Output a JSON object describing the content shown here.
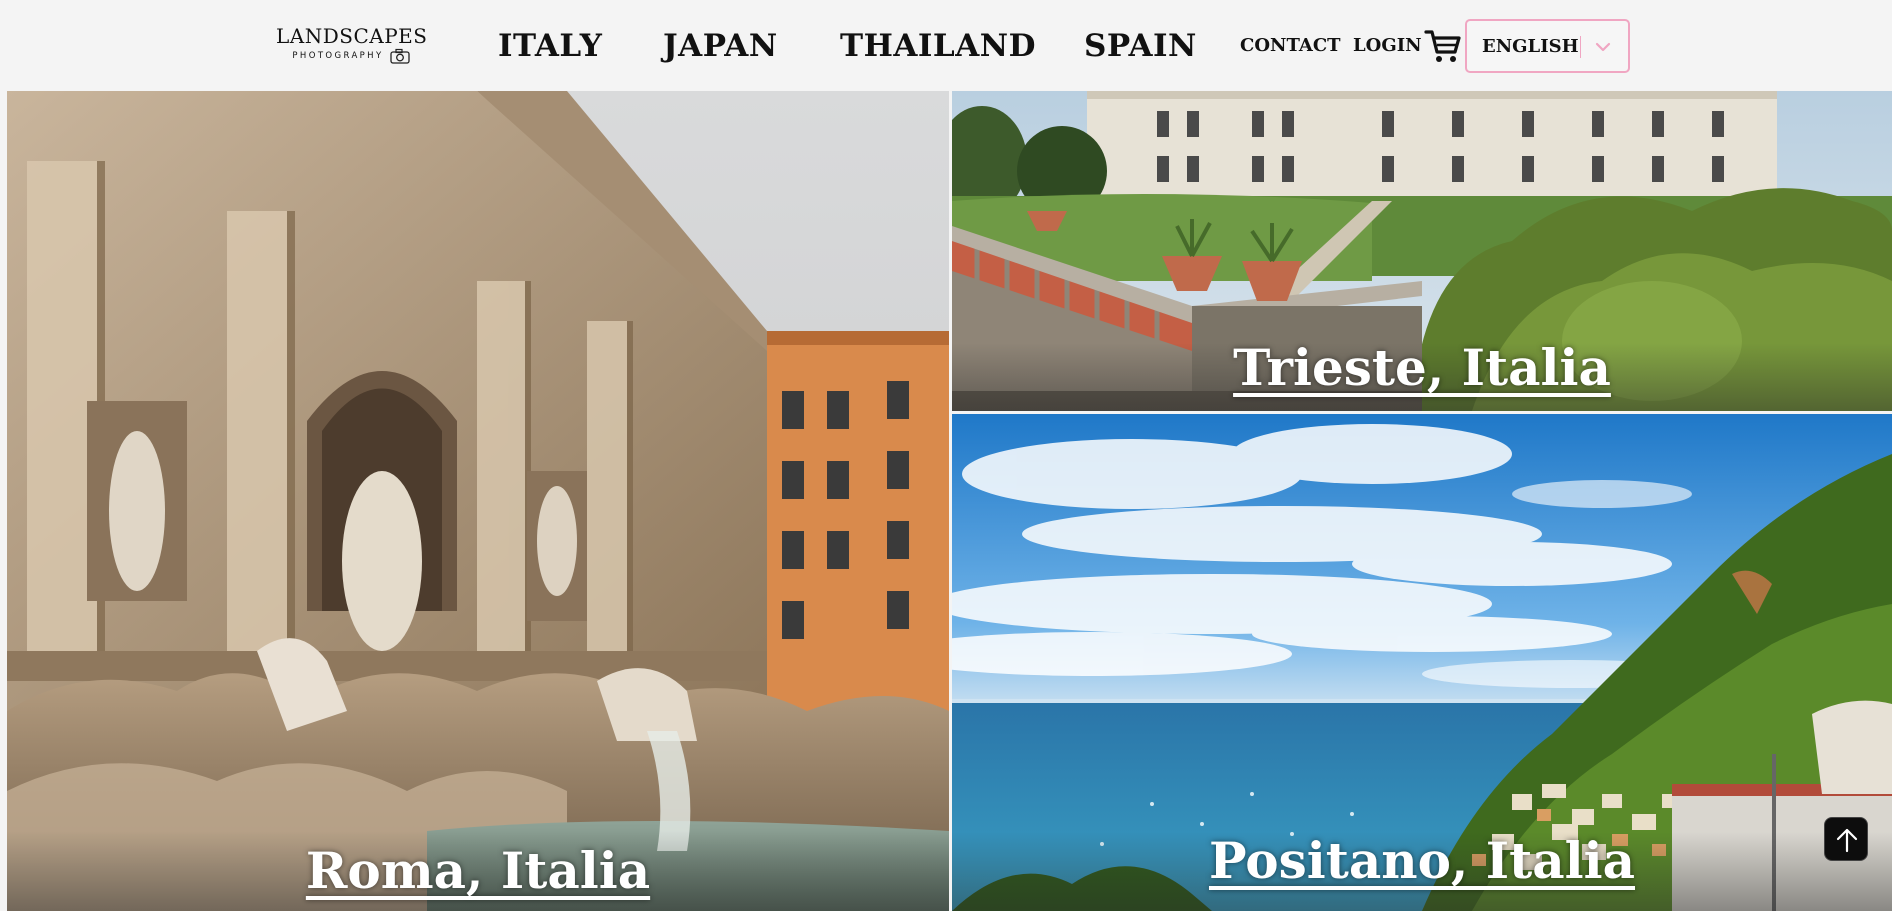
{
  "header": {
    "logo": {
      "title": "LANDSCAPES",
      "subtitle": "PHOTOGRAPHY"
    },
    "nav": [
      {
        "label": "ITALY"
      },
      {
        "label": "JAPAN"
      },
      {
        "label": "THAILAND"
      },
      {
        "label": "SPAIN"
      }
    ],
    "links": {
      "contact": "CONTACT",
      "login": "LOGIN"
    },
    "cart_icon": "shopping-cart-icon",
    "language": {
      "selected": "ENGLISH",
      "chevron_icon": "chevron-down-icon"
    }
  },
  "gallery": [
    {
      "label": "Roma, Italia"
    },
    {
      "label": "Trieste, Italia"
    },
    {
      "label": "Positano, Italia"
    }
  ],
  "back_to_top": {
    "icon": "arrow-up-icon"
  },
  "colors": {
    "header_bg": "#f4f4f4",
    "text": "#111111",
    "select_border": "#f0a6c2",
    "back_to_top_bg": "#0d0d0d"
  }
}
